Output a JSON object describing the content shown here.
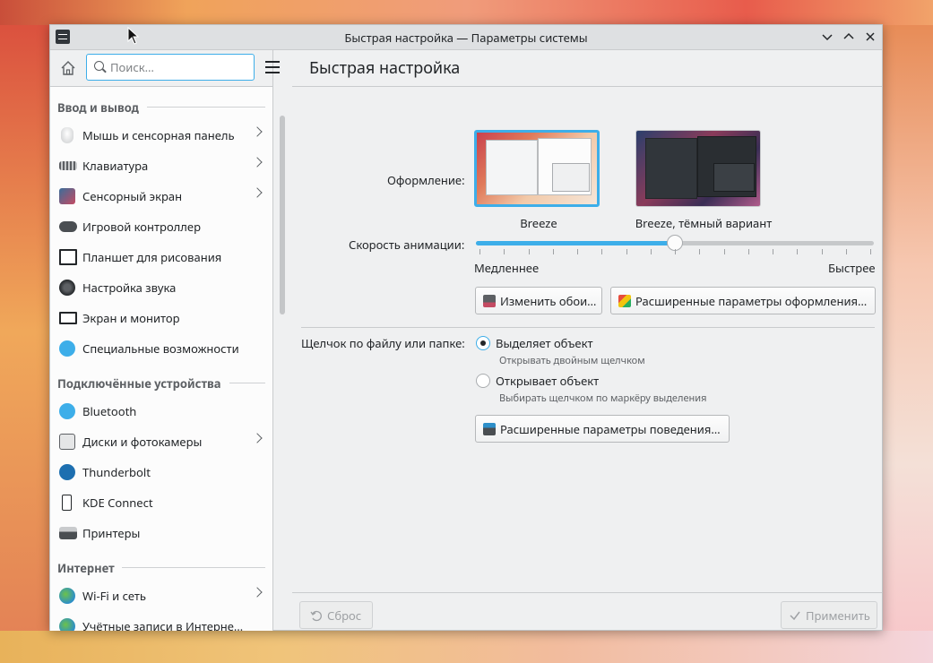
{
  "window": {
    "title": "Быстрая настройка — Параметры системы",
    "controls": {
      "minimize": "⌄",
      "maximize": "⌃",
      "close": "✕"
    }
  },
  "sidebar": {
    "search_placeholder": "Поиск…",
    "groups": [
      {
        "title": "Ввод и вывод"
      },
      {
        "title": "Подключённые устройства"
      },
      {
        "title": "Интернет"
      }
    ],
    "items": [
      {
        "label": "Мышь и сенсорная панель",
        "icon": "mouse-icon",
        "has_submenu": true
      },
      {
        "label": "Клавиатура",
        "icon": "keyboard-icon",
        "has_submenu": true
      },
      {
        "label": "Сенсорный экран",
        "icon": "touchscreen-icon",
        "has_submenu": true
      },
      {
        "label": "Игровой контроллер",
        "icon": "gamepad-icon",
        "has_submenu": false
      },
      {
        "label": "Планшет для рисования",
        "icon": "tablet-icon",
        "has_submenu": false
      },
      {
        "label": "Настройка звука",
        "icon": "audio-icon",
        "has_submenu": false
      },
      {
        "label": "Экран и монитор",
        "icon": "monitor-icon",
        "has_submenu": false
      },
      {
        "label": "Специальные возможности",
        "icon": "accessibility-icon",
        "has_submenu": false
      },
      {
        "label": "Bluetooth",
        "icon": "bluetooth-icon",
        "has_submenu": false
      },
      {
        "label": "Диски и фотокамеры",
        "icon": "disk-icon",
        "has_submenu": true
      },
      {
        "label": "Thunderbolt",
        "icon": "thunderbolt-icon",
        "has_submenu": false
      },
      {
        "label": "KDE Connect",
        "icon": "kdeconnect-icon",
        "has_submenu": false
      },
      {
        "label": "Принтеры",
        "icon": "printer-icon",
        "has_submenu": false
      },
      {
        "label": "Wi-Fi и сеть",
        "icon": "network-icon",
        "has_submenu": true
      },
      {
        "label": "Учётные записи в Интерне…",
        "icon": "accounts-icon",
        "has_submenu": false
      }
    ]
  },
  "main": {
    "title": "Быстрая настройка",
    "appearance_label": "Оформление:",
    "themes": [
      {
        "name": "Breeze",
        "selected": true
      },
      {
        "name": "Breeze, тёмный вариант",
        "selected": false
      }
    ],
    "animation_label": "Скорость анимации:",
    "animation_slower": "Медленнее",
    "animation_faster": "Быстрее",
    "animation_value_fraction": 0.5,
    "wallpaper_button": "Изменить обои…",
    "advanced_appearance_button": "Расширенные параметры оформления…",
    "click_label": "Щелчок по файлу или папке:",
    "click_options": [
      {
        "label": "Выделяет объект",
        "hint": "Открывать двойным щелчком",
        "selected": true
      },
      {
        "label": "Открывает объект",
        "hint": "Выбирать щелчком по маркёру выделения",
        "selected": false
      }
    ],
    "advanced_behavior_button": "Расширенные параметры поведения…"
  },
  "footer": {
    "reset": "Сброс",
    "apply": "Применить"
  },
  "colors": {
    "accent": "#3daee9",
    "window_bg": "#eff0f1",
    "sidebar_bg": "#fcfcfc"
  }
}
